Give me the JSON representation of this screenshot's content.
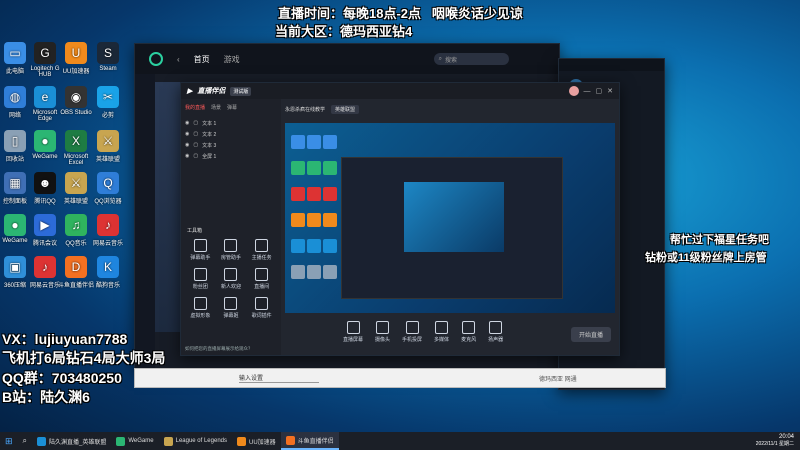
{
  "overlay": {
    "schedule": "直播时间：每晚18点-2点   咽喉炎话少见谅",
    "region": "当前大区：德玛西亚钻4",
    "side_note_1": "帮忙过下福星任务吧",
    "side_note_2": "钻粉或11级粉丝牌上房管",
    "vx": "VX：lujiuyuan7788",
    "plane": "飞机打6局钻石4局大师3局",
    "qq": "QQ群：703480250",
    "bilibili": "B站：陆久渊6"
  },
  "desktop_icons": [
    {
      "label": "此电脑",
      "color": "#3a8ee6",
      "glyph": "▭"
    },
    {
      "label": "网络",
      "color": "#2f7ed8",
      "glyph": "◍"
    },
    {
      "label": "回收站",
      "color": "#8aa0b5",
      "glyph": "▯"
    },
    {
      "label": "控制面板",
      "color": "#3f6fb5",
      "glyph": "▦"
    },
    {
      "label": "WeGame",
      "color": "#2bb673",
      "glyph": "●"
    },
    {
      "label": "360压缩",
      "color": "#2f8fd8",
      "glyph": "▣"
    },
    {
      "label": "Logitech G HUB",
      "color": "#222",
      "glyph": "G"
    },
    {
      "label": "Microsoft Edge",
      "color": "#1a8fd6",
      "glyph": "e"
    },
    {
      "label": "WeGame",
      "color": "#2bb673",
      "glyph": "●"
    },
    {
      "label": "腾讯QQ",
      "color": "#111",
      "glyph": "☻"
    },
    {
      "label": "腾讯会议",
      "color": "#2c6bd8",
      "glyph": "▶"
    },
    {
      "label": "网易云音乐",
      "color": "#d33",
      "glyph": "♪"
    },
    {
      "label": "UU加速器",
      "color": "#f08a1c",
      "glyph": "U"
    },
    {
      "label": "OBS Studio",
      "color": "#333",
      "glyph": "◉"
    },
    {
      "label": "Microsoft Excel",
      "color": "#1e7c43",
      "glyph": "X"
    },
    {
      "label": "英雄联盟",
      "color": "#c8a550",
      "glyph": "⚔"
    },
    {
      "label": "QQ音乐",
      "color": "#2fb35e",
      "glyph": "♫"
    },
    {
      "label": "斗鱼直播伴侣",
      "color": "#f37021",
      "glyph": "D"
    },
    {
      "label": "Steam",
      "color": "#1b2838",
      "glyph": "S"
    },
    {
      "label": "必剪",
      "color": "#1aa3e8",
      "glyph": "✂"
    },
    {
      "label": "英雄联盟",
      "color": "#c8a550",
      "glyph": "⚔"
    },
    {
      "label": "QQ浏览器",
      "color": "#2f7ed8",
      "glyph": "Q"
    },
    {
      "label": "网易云音乐",
      "color": "#d33",
      "glyph": "♪"
    },
    {
      "label": "酷狗音乐",
      "color": "#1f86e0",
      "glyph": "K"
    }
  ],
  "wegame": {
    "tab_home": "首页",
    "tab_games": "游戏",
    "search_placeholder": "搜索"
  },
  "companion": {
    "logo": "直播伴侣",
    "version": "测试版",
    "scene_tabs": [
      "我的直播",
      "场景",
      "弹幕"
    ],
    "sources": [
      "文本 1",
      "文本 2",
      "文本 3",
      "全屏 1"
    ],
    "tools_title": "工具箱",
    "tools": [
      "弹幕助手",
      "房管助手",
      "主播任务",
      "粉丝团",
      "新人欢迎",
      "直播间",
      "虚拟形象",
      "弹幕姬",
      "歌词插件"
    ],
    "title_input": "永恩杀疯在线教学",
    "category": "英雄联盟",
    "bottom_tools": [
      "直播屏幕",
      "摄像头",
      "手机投屏",
      "多媒体",
      "麦克风",
      "扬声器"
    ],
    "start_button": "开始直播",
    "hint": "如何把您的直播屏幕展示给观众？"
  },
  "lol_taskbar_hint": "输入设置",
  "stream_status": "德玛西亚 网通",
  "taskbar": {
    "items": [
      "陆久渊直播_英雄联盟",
      "WeGame",
      "League of Legends",
      "UU加速器",
      "斗鱼直播伴侣"
    ],
    "time": "20:04",
    "date": "2022/11/1 星期二"
  }
}
